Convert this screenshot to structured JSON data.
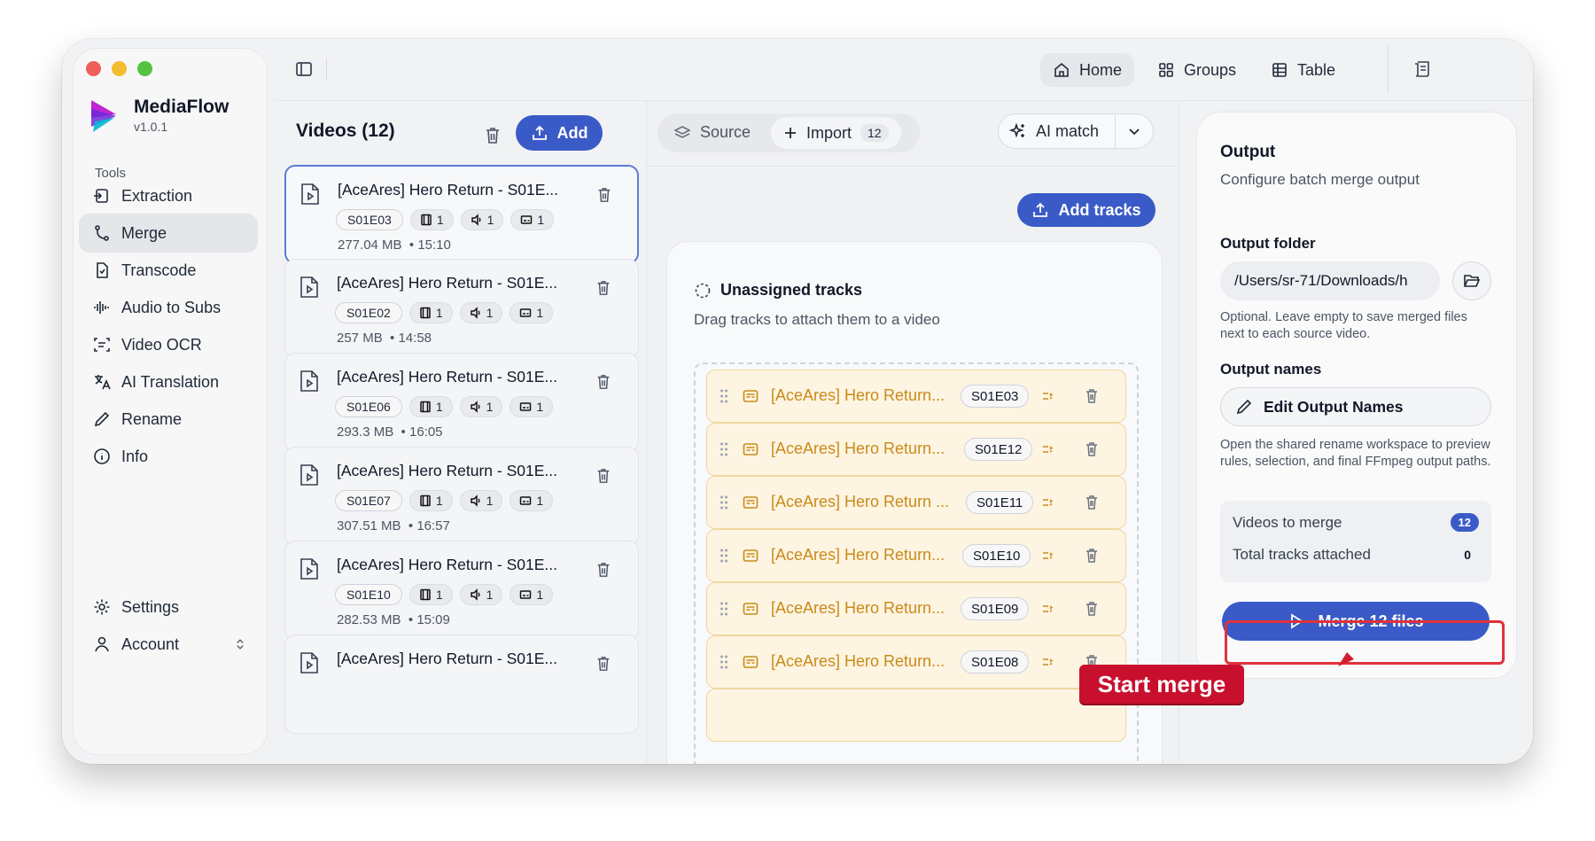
{
  "app": {
    "name": "MediaFlow",
    "version": "v1.0.1"
  },
  "sidebar": {
    "section_label": "Tools",
    "items": [
      {
        "label": "Extraction"
      },
      {
        "label": "Merge"
      },
      {
        "label": "Transcode"
      },
      {
        "label": "Audio to Subs"
      },
      {
        "label": "Video OCR"
      },
      {
        "label": "AI Translation"
      },
      {
        "label": "Rename"
      },
      {
        "label": "Info"
      }
    ],
    "settings_label": "Settings",
    "account_label": "Account"
  },
  "topbar": {
    "home": "Home",
    "groups": "Groups",
    "table": "Table"
  },
  "videos": {
    "title": "Videos (12)",
    "add_label": "Add",
    "items": [
      {
        "title": "[AceAres] Hero Return - S01E...",
        "code": "S01E03",
        "video": "1",
        "audio": "1",
        "subs": "1",
        "size": "277.04 MB",
        "duration": "15:10"
      },
      {
        "title": "[AceAres] Hero Return - S01E...",
        "code": "S01E02",
        "video": "1",
        "audio": "1",
        "subs": "1",
        "size": "257 MB",
        "duration": "14:58"
      },
      {
        "title": "[AceAres] Hero Return - S01E...",
        "code": "S01E06",
        "video": "1",
        "audio": "1",
        "subs": "1",
        "size": "293.3 MB",
        "duration": "16:05"
      },
      {
        "title": "[AceAres] Hero Return - S01E...",
        "code": "S01E07",
        "video": "1",
        "audio": "1",
        "subs": "1",
        "size": "307.51 MB",
        "duration": "16:57"
      },
      {
        "title": "[AceAres] Hero Return - S01E...",
        "code": "S01E10",
        "video": "1",
        "audio": "1",
        "subs": "1",
        "size": "282.53 MB",
        "duration": "15:09"
      },
      {
        "title": "[AceAres] Hero Return - S01E..."
      }
    ]
  },
  "tracks": {
    "source_label": "Source",
    "import_label": "Import",
    "import_count": "12",
    "ai_match_label": "AI match",
    "add_tracks_label": "Add tracks",
    "unassigned_title": "Unassigned tracks",
    "unassigned_sub": "Drag tracks to attach them to a video",
    "items": [
      {
        "name": "[AceAres] Hero Return...",
        "code": "S01E03"
      },
      {
        "name": "[AceAres] Hero Return...",
        "code": "S01E12"
      },
      {
        "name": "[AceAres] Hero Return ...",
        "code": "S01E11"
      },
      {
        "name": "[AceAres] Hero Return...",
        "code": "S01E10"
      },
      {
        "name": "[AceAres] Hero Return...",
        "code": "S01E09"
      },
      {
        "name": "[AceAres] Hero Return...",
        "code": "S01E08"
      }
    ]
  },
  "output": {
    "title": "Output",
    "subtitle": "Configure batch merge output",
    "folder_label": "Output folder",
    "folder_value": "/Users/sr-71/Downloads/h",
    "folder_hint": "Optional. Leave empty to save merged files next to each source video.",
    "names_label": "Output names",
    "edit_names": "Edit Output Names",
    "names_hint": "Open the shared rename workspace to preview rules, selection, and final FFmpeg output paths.",
    "videos_to_merge_label": "Videos to merge",
    "videos_to_merge": "12",
    "tracks_attached_label": "Total tracks attached",
    "tracks_attached": "0",
    "merge_label": "Merge 12 files"
  },
  "annotation": {
    "callout": "Start merge"
  },
  "colors": {
    "accent": "#3a5bc7",
    "track_bg": "#fdf4e2",
    "track_text": "#c98b18",
    "highlight": "#e0323a"
  }
}
